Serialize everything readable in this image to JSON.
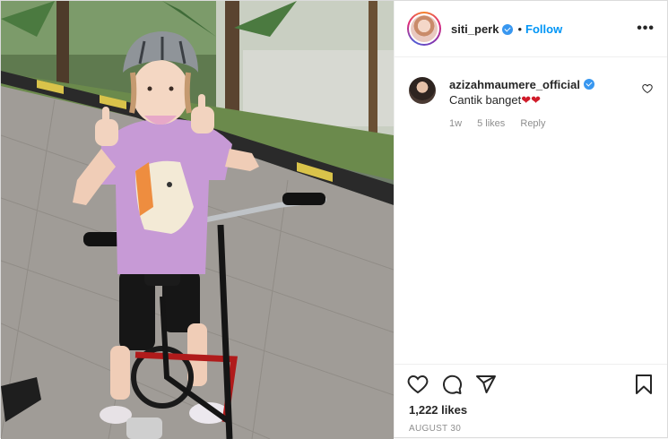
{
  "post": {
    "author": {
      "username": "siti_perk",
      "follow_label": "Follow",
      "separator": "•",
      "more_label": "•••"
    },
    "comments": [
      {
        "username": "azizahmaumere_official",
        "text": "Cantik banget",
        "emoji": "❤❤",
        "age": "1w",
        "likes": "5 likes",
        "reply_label": "Reply"
      }
    ],
    "likes_count": "1,222 likes",
    "date": "AUGUST 30"
  }
}
